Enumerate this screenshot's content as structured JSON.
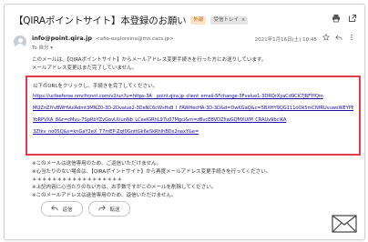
{
  "subject": "【QIRAポイントサイト】本登録のお願い",
  "chips": {
    "external": "外部",
    "inbox": "受信トレイ",
    "inbox_close": "×"
  },
  "toolbar": {
    "print_icon": "printer-icon",
    "open_icon": "open-in-new-icon"
  },
  "sender": {
    "name": "info@point.qira.jp",
    "address": "<afio-exploreina@mn.cacs.jp>",
    "to": "To 自分 ▾",
    "date": "2021年1月16日(土) 10:45",
    "star_icon": "star-icon",
    "reply_icon": "reply-icon",
    "more_icon": "more-vert-icon"
  },
  "body": {
    "line1": "このメールは、【QIRAポイントサイト】からメールアドレス変更手続きを行った方にお送りしています。",
    "line2": "メールアドレス変更はまだ完了していません。",
    "hl_intro": "以下のURLをクリックし、手続きを完了してください。",
    "links": [
      "https://ucfeeferse.nmcfrcnnt.com/v2/un?u=https-3A__point.qira.jp_client_email-5Fchange-3Fvalue1-3DRQrXyaCd9CK7JRFYfQm",
      "MQZnZlYvBWHVuIAdmt3MNZ0-3D-2Dvalue2-3DeNC6cWsHsB_I_FAWHecHA-3D-3D&d=DwKGaQ&c=5BXHY9QG111oOk5mCNfRUvuwsWEYPB3S",
      "YoRPVXA_8&r=cMvu-7SpRbYZvGovUUunNb_LCeelGRhL97u07Mgci&m=zBvcEBVDZfiwGQMXUiM_CRAUv9bciKA",
      "3Ztkv_no0SQ&s=knGaY2eX_77mEP-Zqt0GnttGk6eSkRhlhBDx2oaxY&e="
    ],
    "line3": "※このメールは送信専用のため、ご返信いただけません。",
    "line4": "※心当たりのない場合は、【QIRAポイントサイト】から再度メールアドレス変更手続きを行ってください。",
    "separator": "＊＊＊＊＊＊＊＊＊＊＊＊＊＊＊＊＊＊",
    "line5": "※上記内容に心当たりのない方は、お手数ですがこのメールを削除してください。",
    "line6": "※このメールアドレスは送信専用のため、返信いただけません。"
  },
  "actions": {
    "reply": "返信",
    "forward": "転送",
    "reply_icon": "reply-arrow-icon",
    "forward_icon": "forward-arrow-icon"
  },
  "decor": {
    "envelope_icon": "envelope-icon"
  },
  "colors": {
    "highlight": "#e23a4f",
    "link": "#1a0dab"
  }
}
